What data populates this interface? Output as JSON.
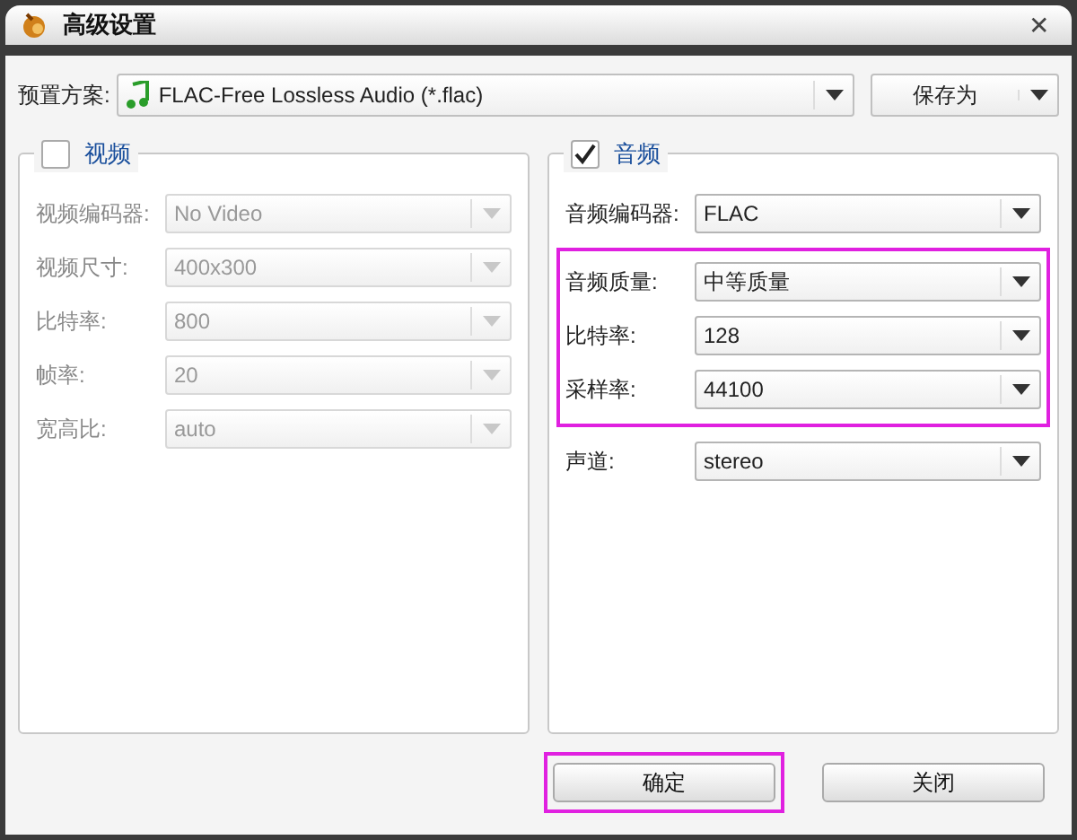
{
  "window": {
    "title": "高级设置",
    "close": "✕"
  },
  "preset": {
    "label": "预置方案:",
    "value": "FLAC-Free Lossless Audio (*.flac)",
    "save_as": "保存为"
  },
  "sections": [
    {
      "title": "视频",
      "checked": false,
      "fields": [
        {
          "label": "视频编码器:",
          "value": "No Video",
          "highlighted": false
        },
        {
          "label": "视频尺寸:",
          "value": "400x300",
          "highlighted": false
        },
        {
          "label": "比特率:",
          "value": "800",
          "highlighted": false
        },
        {
          "label": "帧率:",
          "value": "20",
          "highlighted": false
        },
        {
          "label": "宽高比:",
          "value": "auto",
          "highlighted": false
        }
      ]
    },
    {
      "title": "音频",
      "checked": true,
      "fields": [
        {
          "label": "音频编码器:",
          "value": "FLAC",
          "highlighted": false
        },
        {
          "label": "音频质量:",
          "value": "中等质量",
          "highlighted": true
        },
        {
          "label": "比特率:",
          "value": "128",
          "highlighted": true
        },
        {
          "label": "采样率:",
          "value": "44100",
          "highlighted": true
        },
        {
          "label": "声道:",
          "value": "stereo",
          "highlighted": false
        }
      ]
    }
  ],
  "buttons": [
    {
      "label": "确定",
      "highlighted": true
    },
    {
      "label": "关闭",
      "highlighted": false
    }
  ]
}
